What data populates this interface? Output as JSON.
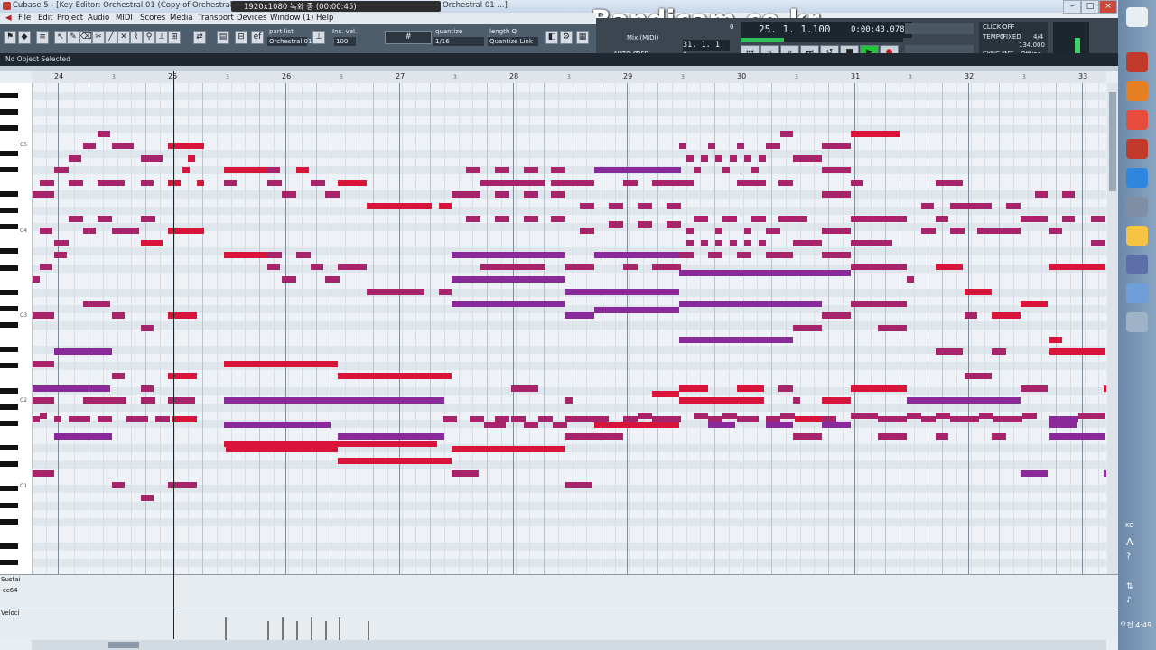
{
  "window": {
    "title": "Cubase 5 - [Key Editor: Orchestral 01 (Copy of Orchestral 01_Orch",
    "title_suffix": "Orchestral 01 ...]",
    "recorder_text": "1920x1080  녹화 중 (00:00:45)",
    "watermark": "www.Bandicam.co.kr"
  },
  "menu": [
    "File",
    "Edit",
    "Project",
    "Audio",
    "MIDI",
    "Scores",
    "Media",
    "Transport",
    "Devices",
    "Window (1)",
    "Help"
  ],
  "toolbar": {
    "part_list_label": "part list",
    "part_list_value": "Orchestral 01",
    "ins_vel_label": "Ins. vel.",
    "ins_vel_value": "100",
    "quantize_label": "quantize",
    "quantize_value": "1/16",
    "length_q_label": "length Q",
    "length_q_value": "Quantize Link"
  },
  "transport": {
    "position_bars": "25. 1. 1.100",
    "position_time": "0:00:43.078",
    "right_locator": "31. 1. 1.   0",
    "left_value": "0",
    "mix_label": "Mix (MIDI)",
    "auto_label": "AUTO Q",
    "auto_value": "OFF",
    "click_label": "CLICK",
    "click_value": "OFF",
    "tempo_label": "TEMPO",
    "tempo_mode": "FIXED",
    "signature": "4/4",
    "tempo": "134.000",
    "sync_label": "SYNC",
    "sync_mode": "INT.",
    "sync_value": "Offline"
  },
  "info_line": "No Object Selected",
  "ruler": {
    "bars": [
      "24",
      "25",
      "26",
      "27",
      "28",
      "29",
      "30",
      "31",
      "32",
      "33"
    ],
    "beat": "3"
  },
  "octave_labels": [
    "C5",
    "C4",
    "C3",
    "C2",
    "C1"
  ],
  "lanes": {
    "lane1_label": "Sustai",
    "lane1_sub": "cc64",
    "lane2_label": "Veloci"
  },
  "taskbar": {
    "tray_label": "KO",
    "clock": "오전 4:49"
  },
  "colors": {
    "note_red": "#d8143a",
    "note_purple": "#8a2a9a",
    "note_magenta": "#a8246a",
    "transport_play": "#22c43a",
    "record": "#d01a1a"
  }
}
